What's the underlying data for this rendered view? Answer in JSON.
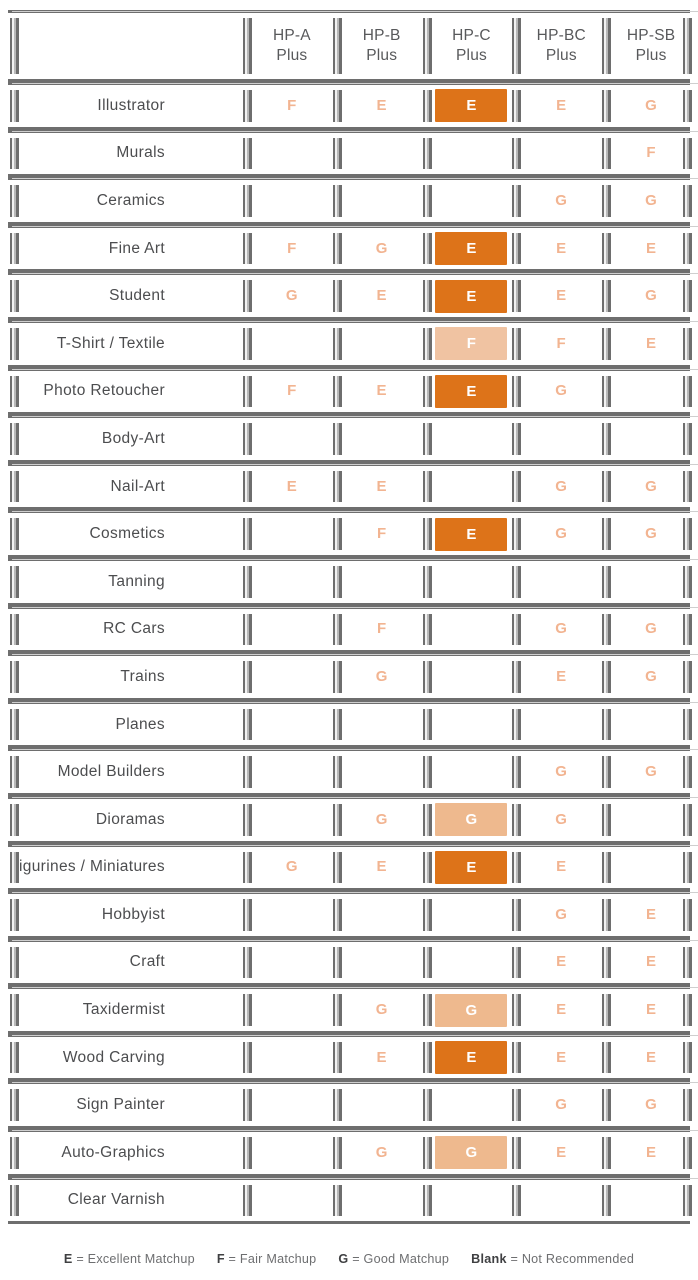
{
  "colors": {
    "excellent_block": "#dd7319",
    "good_block": "#eeb98e",
    "fair_block": "#f0c3a2",
    "plain_mark": "#f2b491",
    "frame": "#6e6e6e",
    "label_text": "#4c4d4f",
    "header_text": "#58595b"
  },
  "table": {
    "corner_label": "",
    "columns": [
      {
        "line1": "HP-A",
        "line2": "Plus"
      },
      {
        "line1": "HP-B",
        "line2": "Plus"
      },
      {
        "line1": "HP-C",
        "line2": "Plus"
      },
      {
        "line1": "HP-BC",
        "line2": "Plus"
      },
      {
        "line1": "HP-SB",
        "line2": "Plus"
      }
    ],
    "rows": [
      {
        "label": "Illustrator",
        "cells": [
          {
            "grade": "F",
            "highlight": false
          },
          {
            "grade": "E",
            "highlight": false
          },
          {
            "grade": "E",
            "highlight": true,
            "level": "e"
          },
          {
            "grade": "E",
            "highlight": false
          },
          {
            "grade": "G",
            "highlight": false
          }
        ]
      },
      {
        "label": "Murals",
        "cells": [
          {
            "grade": "",
            "highlight": false
          },
          {
            "grade": "",
            "highlight": false
          },
          {
            "grade": "",
            "highlight": false
          },
          {
            "grade": "",
            "highlight": false
          },
          {
            "grade": "F",
            "highlight": false
          }
        ]
      },
      {
        "label": "Ceramics",
        "cells": [
          {
            "grade": "",
            "highlight": false
          },
          {
            "grade": "",
            "highlight": false
          },
          {
            "grade": "",
            "highlight": false
          },
          {
            "grade": "G",
            "highlight": false
          },
          {
            "grade": "G",
            "highlight": false
          }
        ]
      },
      {
        "label": "Fine Art",
        "cells": [
          {
            "grade": "F",
            "highlight": false
          },
          {
            "grade": "G",
            "highlight": false
          },
          {
            "grade": "E",
            "highlight": true,
            "level": "e"
          },
          {
            "grade": "E",
            "highlight": false
          },
          {
            "grade": "E",
            "highlight": false
          }
        ]
      },
      {
        "label": "Student",
        "cells": [
          {
            "grade": "G",
            "highlight": false
          },
          {
            "grade": "E",
            "highlight": false
          },
          {
            "grade": "E",
            "highlight": true,
            "level": "e"
          },
          {
            "grade": "E",
            "highlight": false
          },
          {
            "grade": "G",
            "highlight": false
          }
        ]
      },
      {
        "label": "T-Shirt / Textile",
        "cells": [
          {
            "grade": "",
            "highlight": false
          },
          {
            "grade": "",
            "highlight": false
          },
          {
            "grade": "F",
            "highlight": true,
            "level": "f"
          },
          {
            "grade": "F",
            "highlight": false
          },
          {
            "grade": "E",
            "highlight": false
          }
        ]
      },
      {
        "label": "Photo Retoucher",
        "cells": [
          {
            "grade": "F",
            "highlight": false
          },
          {
            "grade": "E",
            "highlight": false
          },
          {
            "grade": "E",
            "highlight": true,
            "level": "e"
          },
          {
            "grade": "G",
            "highlight": false
          },
          {
            "grade": "",
            "highlight": false
          }
        ]
      },
      {
        "label": "Body-Art",
        "cells": [
          {
            "grade": "",
            "highlight": false
          },
          {
            "grade": "",
            "highlight": false
          },
          {
            "grade": "",
            "highlight": false
          },
          {
            "grade": "",
            "highlight": false
          },
          {
            "grade": "",
            "highlight": false
          }
        ]
      },
      {
        "label": "Nail-Art",
        "cells": [
          {
            "grade": "E",
            "highlight": false
          },
          {
            "grade": "E",
            "highlight": false
          },
          {
            "grade": "",
            "highlight": false
          },
          {
            "grade": "G",
            "highlight": false
          },
          {
            "grade": "G",
            "highlight": false
          }
        ]
      },
      {
        "label": "Cosmetics",
        "cells": [
          {
            "grade": "",
            "highlight": false
          },
          {
            "grade": "F",
            "highlight": false
          },
          {
            "grade": "E",
            "highlight": true,
            "level": "e"
          },
          {
            "grade": "G",
            "highlight": false
          },
          {
            "grade": "G",
            "highlight": false
          }
        ]
      },
      {
        "label": "Tanning",
        "cells": [
          {
            "grade": "",
            "highlight": false
          },
          {
            "grade": "",
            "highlight": false
          },
          {
            "grade": "",
            "highlight": false
          },
          {
            "grade": "",
            "highlight": false
          },
          {
            "grade": "",
            "highlight": false
          }
        ]
      },
      {
        "label": "RC Cars",
        "cells": [
          {
            "grade": "",
            "highlight": false
          },
          {
            "grade": "F",
            "highlight": false
          },
          {
            "grade": "",
            "highlight": false
          },
          {
            "grade": "G",
            "highlight": false
          },
          {
            "grade": "G",
            "highlight": false
          }
        ]
      },
      {
        "label": "Trains",
        "cells": [
          {
            "grade": "",
            "highlight": false
          },
          {
            "grade": "G",
            "highlight": false
          },
          {
            "grade": "",
            "highlight": false
          },
          {
            "grade": "E",
            "highlight": false
          },
          {
            "grade": "G",
            "highlight": false
          }
        ]
      },
      {
        "label": "Planes",
        "cells": [
          {
            "grade": "",
            "highlight": false
          },
          {
            "grade": "",
            "highlight": false
          },
          {
            "grade": "",
            "highlight": false
          },
          {
            "grade": "",
            "highlight": false
          },
          {
            "grade": "",
            "highlight": false
          }
        ]
      },
      {
        "label": "Model Builders",
        "cells": [
          {
            "grade": "",
            "highlight": false
          },
          {
            "grade": "",
            "highlight": false
          },
          {
            "grade": "",
            "highlight": false
          },
          {
            "grade": "G",
            "highlight": false
          },
          {
            "grade": "G",
            "highlight": false
          }
        ]
      },
      {
        "label": "Dioramas",
        "cells": [
          {
            "grade": "",
            "highlight": false
          },
          {
            "grade": "G",
            "highlight": false
          },
          {
            "grade": "G",
            "highlight": true,
            "level": "g"
          },
          {
            "grade": "G",
            "highlight": false
          },
          {
            "grade": "",
            "highlight": false
          }
        ]
      },
      {
        "label": "Figurines / Miniatures",
        "cells": [
          {
            "grade": "G",
            "highlight": false
          },
          {
            "grade": "E",
            "highlight": false
          },
          {
            "grade": "E",
            "highlight": true,
            "level": "e"
          },
          {
            "grade": "E",
            "highlight": false
          },
          {
            "grade": "",
            "highlight": false
          }
        ]
      },
      {
        "label": "Hobbyist",
        "cells": [
          {
            "grade": "",
            "highlight": false
          },
          {
            "grade": "",
            "highlight": false
          },
          {
            "grade": "",
            "highlight": false
          },
          {
            "grade": "G",
            "highlight": false
          },
          {
            "grade": "E",
            "highlight": false
          }
        ]
      },
      {
        "label": "Craft",
        "cells": [
          {
            "grade": "",
            "highlight": false
          },
          {
            "grade": "",
            "highlight": false
          },
          {
            "grade": "",
            "highlight": false
          },
          {
            "grade": "E",
            "highlight": false
          },
          {
            "grade": "E",
            "highlight": false
          }
        ]
      },
      {
        "label": "Taxidermist",
        "cells": [
          {
            "grade": "",
            "highlight": false
          },
          {
            "grade": "G",
            "highlight": false
          },
          {
            "grade": "G",
            "highlight": true,
            "level": "g"
          },
          {
            "grade": "E",
            "highlight": false
          },
          {
            "grade": "E",
            "highlight": false
          }
        ]
      },
      {
        "label": "Wood Carving",
        "cells": [
          {
            "grade": "",
            "highlight": false
          },
          {
            "grade": "E",
            "highlight": false
          },
          {
            "grade": "E",
            "highlight": true,
            "level": "e"
          },
          {
            "grade": "E",
            "highlight": false
          },
          {
            "grade": "E",
            "highlight": false
          }
        ]
      },
      {
        "label": "Sign Painter",
        "cells": [
          {
            "grade": "",
            "highlight": false
          },
          {
            "grade": "",
            "highlight": false
          },
          {
            "grade": "",
            "highlight": false
          },
          {
            "grade": "G",
            "highlight": false
          },
          {
            "grade": "G",
            "highlight": false
          }
        ]
      },
      {
        "label": "Auto-Graphics",
        "cells": [
          {
            "grade": "",
            "highlight": false
          },
          {
            "grade": "G",
            "highlight": false
          },
          {
            "grade": "G",
            "highlight": true,
            "level": "g"
          },
          {
            "grade": "E",
            "highlight": false
          },
          {
            "grade": "E",
            "highlight": false
          }
        ]
      },
      {
        "label": "Clear Varnish",
        "cells": [
          {
            "grade": "",
            "highlight": false
          },
          {
            "grade": "",
            "highlight": false
          },
          {
            "grade": "",
            "highlight": false
          },
          {
            "grade": "",
            "highlight": false
          },
          {
            "grade": "",
            "highlight": false
          }
        ]
      }
    ]
  },
  "legend": [
    {
      "key": "E",
      "eq": "=",
      "text": "Excellent Matchup"
    },
    {
      "key": "F",
      "eq": "=",
      "text": "Fair Matchup"
    },
    {
      "key": "G",
      "eq": "=",
      "text": "Good Matchup"
    },
    {
      "key": "Blank",
      "eq": "=",
      "text": "Not Recommended"
    }
  ]
}
